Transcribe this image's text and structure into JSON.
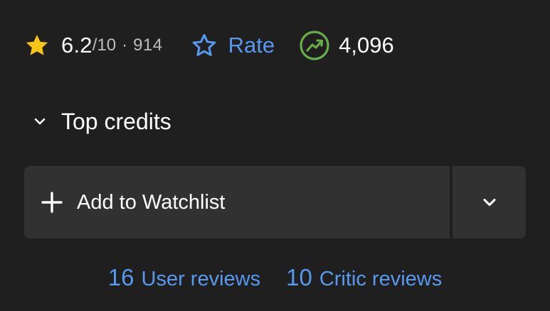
{
  "rating": {
    "value": "6.2",
    "max": "/10",
    "separator": "·",
    "count": "914",
    "star_color": "#f5c518"
  },
  "rate": {
    "label": "Rate",
    "color": "#5799ef"
  },
  "popularity": {
    "value": "4,096",
    "icon_color": "#67ad4b"
  },
  "top_credits": {
    "label": "Top credits"
  },
  "watchlist": {
    "label": "Add to Watchlist"
  },
  "reviews": {
    "user": {
      "count": "16",
      "label": "User reviews"
    },
    "critic": {
      "count": "10",
      "label": "Critic reviews"
    }
  }
}
